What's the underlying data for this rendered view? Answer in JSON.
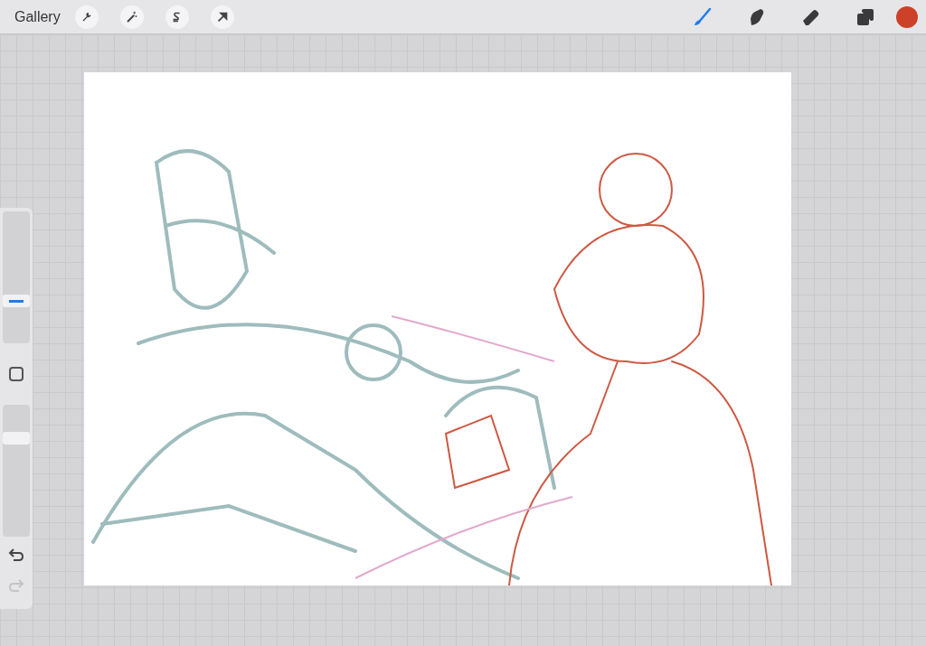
{
  "toolbar": {
    "gallery": "Gallery",
    "actions": [
      {
        "kind": "wrench"
      },
      {
        "kind": "wand"
      },
      {
        "kind": "selection"
      },
      {
        "kind": "transform"
      }
    ],
    "tools": [
      {
        "kind": "brush",
        "selected": true
      },
      {
        "kind": "smudge",
        "selected": false
      },
      {
        "kind": "eraser",
        "selected": false
      },
      {
        "kind": "layers",
        "selected": false
      }
    ],
    "color": "#cc4128"
  },
  "sidebar": {
    "size_slider": {
      "level": 0.3
    },
    "opacity_slider": {
      "level": 0.77
    },
    "undo": {
      "disabled": false
    },
    "redo": {
      "disabled": true
    }
  }
}
